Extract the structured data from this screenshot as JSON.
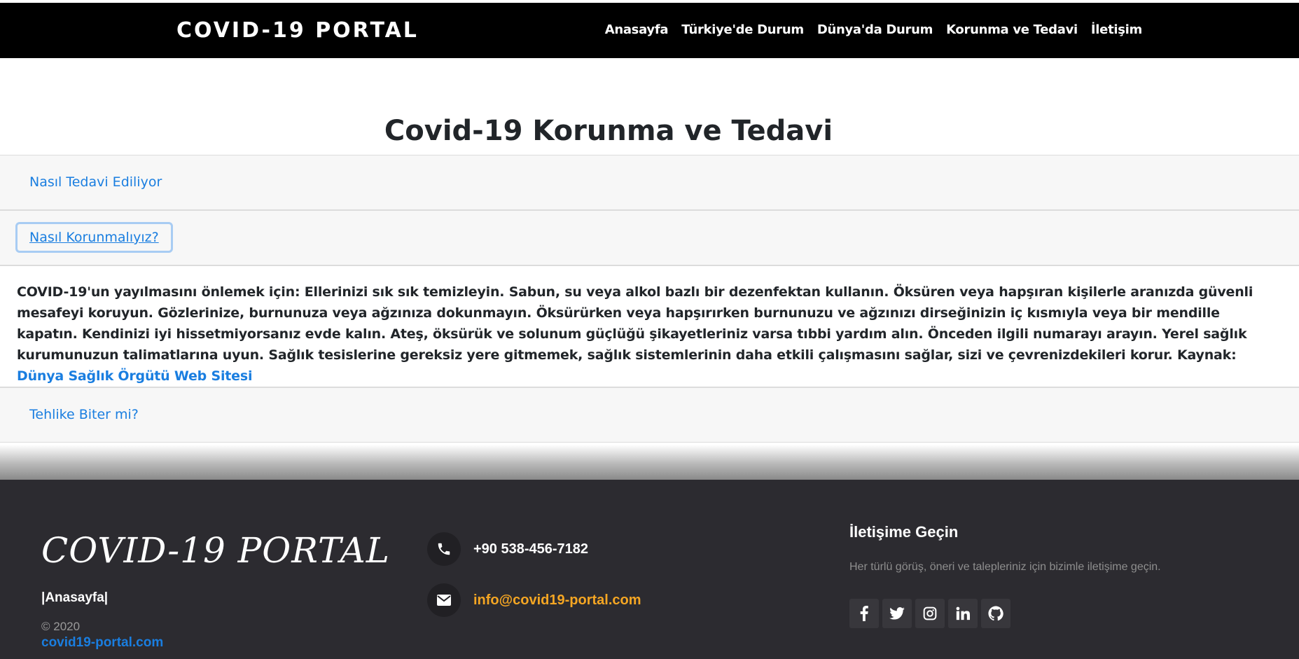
{
  "navbar": {
    "brand": "COVID-19 PORTAL",
    "links": [
      "Anasayfa",
      "Türkiye'de Durum",
      "Dünya'da Durum",
      "Korunma ve Tedavi",
      "İletişim"
    ]
  },
  "page": {
    "title": "Covid-19 Korunma ve Tedavi"
  },
  "accordion": {
    "items": [
      {
        "label": "Nasıl Tedavi Ediliyor"
      },
      {
        "label": "Nasıl Korunmalıyız?"
      },
      {
        "label": "Tehlike Biter mi?"
      }
    ],
    "open_body": {
      "text": "COVID-19'un yayılmasını önlemek için: Ellerinizi sık sık temizleyin. Sabun, su veya alkol bazlı bir dezenfektan kullanın. Öksüren veya hapşıran kişilerle aranızda güvenli mesafeyi koruyun. Gözlerinize, burnunuza veya ağzınıza dokunmayın. Öksürürken veya hapşırırken burnunuzu ve ağzınızı dirseğinizin iç kısmıyla veya bir mendille kapatın. Kendinizi iyi hissetmiyorsanız evde kalın. Ateş, öksürük ve solunum güçlüğü şikayetleriniz varsa tıbbi yardım alın. Önceden ilgili numarayı arayın. Yerel sağlık kurumunuzun talimatlarına uyun. Sağlık tesislerine gereksiz yere gitmemek, sağlık sistemlerinin daha etkili çalışmasını sağlar, sizi ve çevrenizdekileri korur. Kaynak: ",
      "link_text": "Dünya Sağlık Örgütü Web Sitesi"
    }
  },
  "footer": {
    "brand": "COVID-19 PORTAL",
    "home_link": "|Anasayfa|",
    "copyright": "© 2020",
    "site": "covid19-portal.com",
    "phone": "+90 538-456-7182",
    "email": "info@covid19-portal.com",
    "contact_heading": "İletişime Geçin",
    "contact_desc": "Her türlü görüş, öneri ve talepleriniz için bizimle iletişime geçin.",
    "social_icons": [
      "facebook-icon",
      "twitter-icon",
      "instagram-icon",
      "linkedin-icon",
      "github-icon"
    ]
  },
  "colors": {
    "navbar_bg": "#000000",
    "link_blue": "#1a7ee0",
    "footer_bg": "#2c2b30",
    "email_orange": "#f5a623"
  }
}
